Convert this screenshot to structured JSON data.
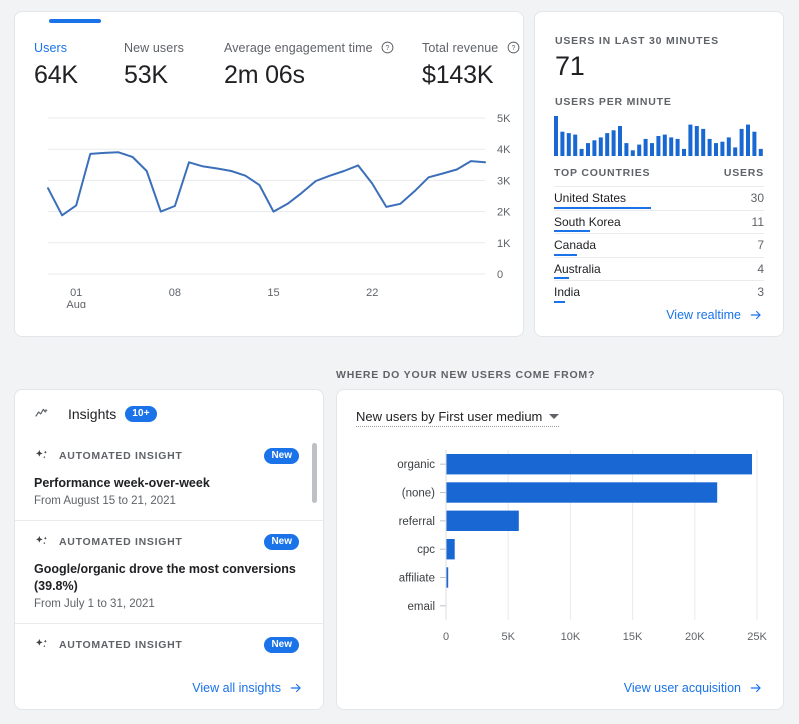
{
  "overview": {
    "metrics": [
      {
        "label": "Users",
        "value": "64K",
        "has_help": false,
        "accent": true
      },
      {
        "label": "New users",
        "value": "53K",
        "has_help": false,
        "accent": false
      },
      {
        "label": "Average engagement time",
        "value": "2m 06s",
        "has_help": true,
        "accent": false
      },
      {
        "label": "Total revenue",
        "value": "$143K",
        "has_help": true,
        "accent": false
      }
    ]
  },
  "realtime": {
    "users_label": "USERS IN LAST 30 MINUTES",
    "users_value": "71",
    "per_minute_label": "USERS PER MINUTE",
    "per_minute_values": [
      28,
      17,
      16,
      15,
      5,
      9,
      11,
      13,
      16,
      18,
      21,
      9,
      4,
      8,
      12,
      9,
      14,
      15,
      13,
      12,
      5,
      22,
      21,
      19,
      12,
      9,
      10,
      13,
      6,
      19,
      22,
      17,
      5
    ],
    "table_header": {
      "dimension": "TOP COUNTRIES",
      "metric": "USERS"
    },
    "rows": [
      {
        "country": "United States",
        "users": "30",
        "bar_pct": 46
      },
      {
        "country": "South Korea",
        "users": "11",
        "bar_pct": 17
      },
      {
        "country": "Canada",
        "users": "7",
        "bar_pct": 11
      },
      {
        "country": "Australia",
        "users": "4",
        "bar_pct": 7
      },
      {
        "country": "India",
        "users": "3",
        "bar_pct": 5
      }
    ],
    "footer_link": "View realtime"
  },
  "section": {
    "title": "WHERE DO YOUR NEW USERS COME FROM?"
  },
  "insights": {
    "title": "Insights",
    "badge": "10+",
    "items": [
      {
        "kind": "AUTOMATED INSIGHT",
        "badge": "New",
        "headline": "Performance week-over-week",
        "range": "From August 15 to 21, 2021"
      },
      {
        "kind": "AUTOMATED INSIGHT",
        "badge": "New",
        "headline": "Google/organic drove the most conversions (39.8%)",
        "range": "From July 1 to 31, 2021"
      },
      {
        "kind": "AUTOMATED INSIGHT",
        "badge": "New",
        "headline": "",
        "range": ""
      }
    ],
    "footer_link": "View all insights"
  },
  "acquisition": {
    "selector_label": "New users by First user medium",
    "footer_link": "View user acquisition"
  },
  "colors": {
    "accent": "#1a73e8",
    "bar": "#1967d2",
    "line": "#3c6fb9",
    "text_primary": "#202124",
    "text_secondary": "#5f6368",
    "page_bg": "#f1f3f4"
  },
  "chart_data": [
    {
      "type": "line",
      "title": "Users over time",
      "xlabel": "",
      "ylabel": "",
      "ylim": [
        0,
        5000
      ],
      "yticks": [
        "0",
        "1K",
        "2K",
        "3K",
        "4K",
        "5K"
      ],
      "xticks": [
        "01",
        "08",
        "15",
        "22"
      ],
      "xtick_sublabel": "Aug",
      "grid": true,
      "x": [
        0,
        1,
        2,
        3,
        4,
        5,
        6,
        7,
        8,
        9,
        10,
        11,
        12,
        13,
        14,
        15,
        16,
        17,
        18,
        19,
        20,
        21,
        22,
        23,
        24,
        25,
        26,
        27,
        28,
        29,
        30,
        31
      ],
      "values": [
        2750,
        1880,
        2200,
        3850,
        3880,
        3900,
        3750,
        3300,
        2000,
        2180,
        3580,
        3450,
        3380,
        3300,
        3150,
        2850,
        2000,
        2250,
        2600,
        2980,
        3150,
        3300,
        3480,
        2900,
        2150,
        2250,
        2650,
        3100,
        3220,
        3350,
        3620,
        3580
      ]
    },
    {
      "type": "bar",
      "orientation": "horizontal",
      "title": "New users by First user medium",
      "categories": [
        "organic",
        "(none)",
        "referral",
        "cpc",
        "affiliate",
        "email"
      ],
      "values": [
        24600,
        21800,
        5850,
        700,
        180,
        30
      ],
      "xlabel": "",
      "ylabel": "",
      "xlim": [
        0,
        25000
      ],
      "xticks": [
        "0",
        "5K",
        "10K",
        "15K",
        "20K",
        "25K"
      ],
      "grid": true
    },
    {
      "type": "bar",
      "orientation": "vertical",
      "title": "Users per minute",
      "categories": [
        "1",
        "2",
        "3",
        "4",
        "5",
        "6",
        "7",
        "8",
        "9",
        "10",
        "11",
        "12",
        "13",
        "14",
        "15",
        "16",
        "17",
        "18",
        "19",
        "20",
        "21",
        "22",
        "23",
        "24",
        "25",
        "26",
        "27",
        "28",
        "29",
        "30",
        "31",
        "32",
        "33"
      ],
      "values": [
        28,
        17,
        16,
        15,
        5,
        9,
        11,
        13,
        16,
        18,
        21,
        9,
        4,
        8,
        12,
        9,
        14,
        15,
        13,
        12,
        5,
        22,
        21,
        19,
        12,
        9,
        10,
        13,
        6,
        19,
        22,
        17,
        5
      ],
      "grid": false
    }
  ]
}
